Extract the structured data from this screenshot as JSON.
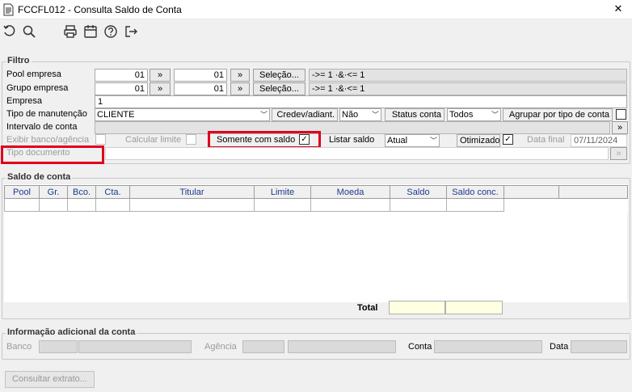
{
  "window": {
    "title": "FCCFL012 - Consulta Saldo de Conta",
    "close_label": "✕"
  },
  "toolbar": {
    "icons": [
      "refresh-icon",
      "search-icon",
      "print-icon",
      "calendar-icon",
      "help-icon",
      "exit-icon"
    ]
  },
  "filtro": {
    "group_title": "Filtro",
    "pool_empresa": {
      "label": "Pool empresa",
      "from": "01",
      "to": "01",
      "select_label": "Seleção...",
      "expr": "->= 1 ·&·<= 1"
    },
    "grupo_empresa": {
      "label": "Grupo empresa",
      "from": "01",
      "to": "01",
      "select_label": "Seleção...",
      "expr": "->= 1 ·&·<= 1"
    },
    "empresa": {
      "label": "Empresa",
      "value": "1"
    },
    "tipo_manutencao": {
      "label": "Tipo de manutenção",
      "value": "CLIENTE"
    },
    "credev": {
      "label": "Credev/adiant.",
      "value": "Não"
    },
    "status_conta": {
      "label": "Status conta",
      "value": "Todos"
    },
    "agrupar": {
      "label": "Agrupar por tipo de conta",
      "checked": false
    },
    "intervalo_conta": {
      "label": "Intervalo de conta",
      "value": ""
    },
    "exibir_banco": {
      "label": "Exibir banco/agência",
      "checked": false
    },
    "calcular_limite": {
      "label": "Calcular limite",
      "checked": false
    },
    "somente_saldo": {
      "label": "Somente com saldo",
      "checked": true,
      "check_mark": "✓"
    },
    "listar_saldo": {
      "label": "Listar saldo",
      "value": "Atual"
    },
    "otimizado": {
      "label": "Otimizado",
      "checked": true,
      "check_mark": "✓"
    },
    "data_final": {
      "label": "Data final",
      "value": "07/11/2024"
    },
    "tipo_documento": {
      "label": "Tipo documento",
      "value": ""
    },
    "arrow_label": "»"
  },
  "saldo": {
    "group_title": "Saldo de conta",
    "columns": [
      "Pool",
      "Gr.",
      "Bco.",
      "Cta.",
      "Titular",
      "Limite",
      "Moeda",
      "Saldo",
      "Saldo conc.",
      "",
      ""
    ],
    "total_label": "Total"
  },
  "info": {
    "group_title": "Informação adicional da conta",
    "banco_label": "Banco",
    "agencia_label": "Agência",
    "conta_label": "Conta",
    "data_label": "Data"
  },
  "footer": {
    "consultar_label": "Consultar extrato..."
  },
  "colors": {
    "highlight": "#e0001b",
    "total_bg": "#ffffe1",
    "header_text": "#1a3a8a"
  }
}
